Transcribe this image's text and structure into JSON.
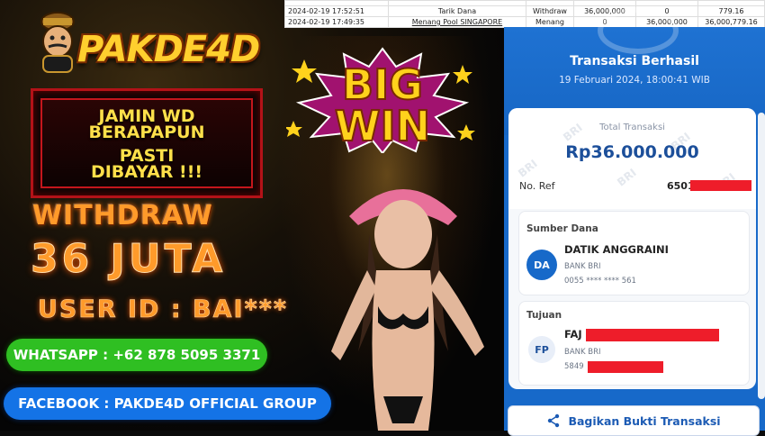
{
  "brand": {
    "name": "PAKDE4D"
  },
  "promo": {
    "banner_lines": [
      "JAMIN WD",
      "BERAPAPUN",
      "PASTI",
      "DIBAYAR !!!"
    ],
    "withdraw_label": "WITHDRAW",
    "withdraw_amount": "36 JUTA",
    "user_id": "USER ID : BAI***",
    "big_win": [
      "BIG",
      "WIN"
    ],
    "whatsapp": "WHATSAPP : +62 878 5095 3371",
    "facebook": "FACEBOOK : PAKDE4D OFFICIAL GROUP"
  },
  "history_table": {
    "rows": [
      [
        "2024-02-19 17:52:51",
        "Tarik Dana",
        "Withdraw",
        "36,000,000",
        "0",
        "779.16"
      ],
      [
        "2024-02-19 17:49:35",
        "Menang Pool SINGAPORE",
        "Menang",
        "0",
        "36,000,000",
        "36,000,779.16"
      ]
    ]
  },
  "receipt": {
    "title": "Transaksi Berhasil",
    "datetime": "19 Februari 2024, 18:00:41 WIB",
    "total_label": "Total Transaksi",
    "total_value": "Rp36.000.000",
    "ref_label": "No. Ref",
    "ref_value": "6501",
    "source_label": "Sumber Dana",
    "source_initials": "DA",
    "source_name": "DATIK ANGGRAINI",
    "source_bank": "BANK BRI",
    "source_account": "0055 **** **** 561",
    "dest_label": "Tujuan",
    "dest_initials": "FP",
    "dest_name": "FAJ",
    "dest_bank": "BANK BRI",
    "dest_account": "5849",
    "share_label": "Bagikan Bukti Transaksi",
    "watermark": "BRI"
  },
  "colors": {
    "accent_orange": "#ff9a2a",
    "whatsapp_green": "#2fbf22",
    "facebook_blue": "#1473e6",
    "bri_blue": "#1769c9",
    "redaction": "#ee1d2a"
  }
}
